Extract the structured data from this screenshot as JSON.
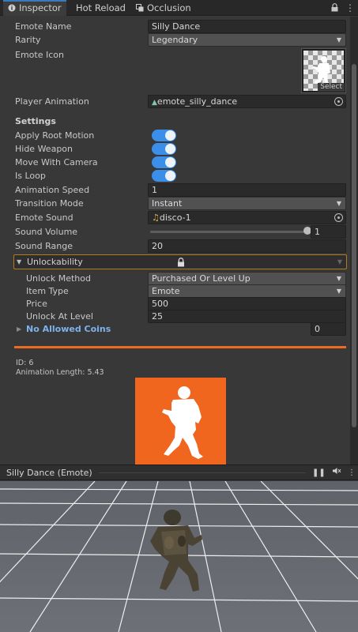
{
  "tabs": [
    {
      "label": "Inspector",
      "icon": "info-icon"
    },
    {
      "label": "Hot Reload",
      "icon": ""
    },
    {
      "label": "Occlusion",
      "icon": "occlusion-icon"
    }
  ],
  "fields": {
    "emote_name": {
      "label": "Emote Name",
      "value": "Silly Dance"
    },
    "rarity": {
      "label": "Rarity",
      "value": "Legendary"
    },
    "emote_icon": {
      "label": "Emote Icon",
      "select": "Select"
    },
    "player_animation": {
      "label": "Player Animation",
      "value": "emote_silly_dance"
    }
  },
  "settings": {
    "header": "Settings",
    "apply_root_motion": {
      "label": "Apply Root Motion",
      "on": true
    },
    "hide_weapon": {
      "label": "Hide Weapon",
      "on": true
    },
    "move_with_camera": {
      "label": "Move With Camera",
      "on": true
    },
    "is_loop": {
      "label": "Is Loop",
      "on": true
    },
    "animation_speed": {
      "label": "Animation Speed",
      "value": "1"
    },
    "transition_mode": {
      "label": "Transition Mode",
      "value": "Instant"
    },
    "emote_sound": {
      "label": "Emote Sound",
      "value": "disco-1"
    },
    "sound_volume": {
      "label": "Sound Volume",
      "value": "1",
      "fraction": 1.0
    },
    "sound_range": {
      "label": "Sound Range",
      "value": "20"
    }
  },
  "unlockability": {
    "label": "Unlockability",
    "unlock_method": {
      "label": "Unlock Method",
      "value": "Purchased Or Level Up"
    },
    "item_type": {
      "label": "Item Type",
      "value": "Emote"
    },
    "price": {
      "label": "Price",
      "value": "500"
    },
    "unlock_at_level": {
      "label": "Unlock At Level",
      "value": "25"
    },
    "no_allowed_coins": {
      "label": "No Allowed Coins",
      "value": "0"
    }
  },
  "info": {
    "id": "ID: 6",
    "animation_length": "Animation Length: 5.43"
  },
  "preview": {
    "title": "Silly Dance (Emote)"
  },
  "colors": {
    "accent_orange": "#ee6b22",
    "toggle_blue": "#3b8fe8",
    "link_blue": "#7fb2ea",
    "foldout_border": "#b47b1d"
  }
}
